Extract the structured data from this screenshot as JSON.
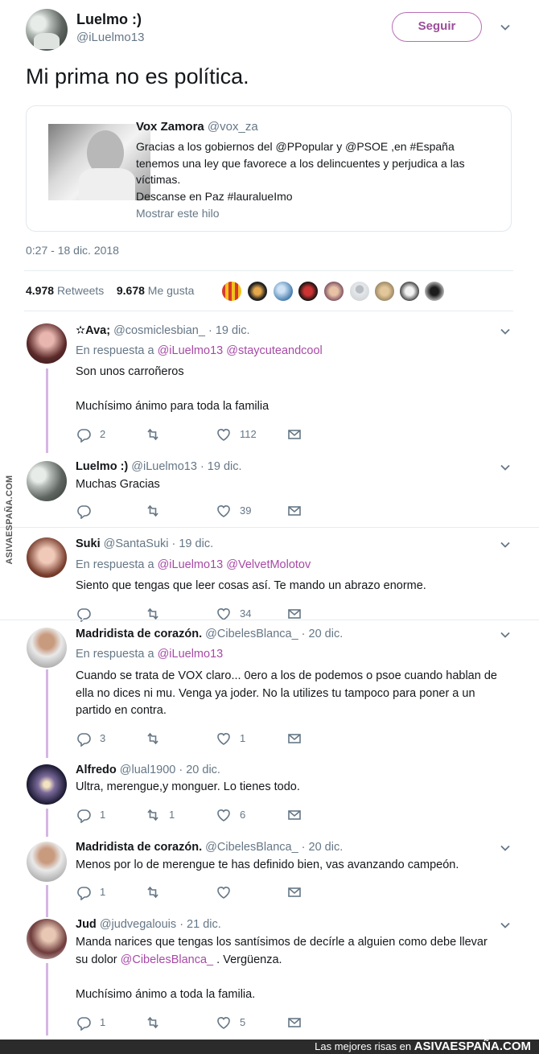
{
  "author": {
    "name": "Luelmo :)",
    "handle": "@iLuelmo13",
    "follow_label": "Seguir"
  },
  "tweet": {
    "text": "Mi prima no es política."
  },
  "quoted": {
    "name": "Vox Zamora",
    "handle": "@vox_za",
    "lines": [
      "Gracias a los gobiernos del @PPopular y @PSOE  ,en #España",
      "tenemos una ley que favorece a los delincuentes y perjudica a las",
      "víctimas.",
      "Descanse en Paz #lauralueImo"
    ],
    "show_thread": "Mostrar este hilo"
  },
  "timestamp": "0:27 - 18 dic. 2018",
  "stats": {
    "retweets": "4.978",
    "retweets_label": "Retweets",
    "likes": "9.678",
    "likes_label": "Me gusta"
  },
  "replies": [
    {
      "name": "✫Ava;",
      "handle": "@cosmiclesbian_",
      "date": "· 19 dic.",
      "respond_prefix": "En respuesta a",
      "mentions": [
        "@iLuelmo13",
        "@staycuteandcool"
      ],
      "lines": [
        "Son unos carroñeros",
        "",
        "Muchísimo ánimo para toda la familia"
      ],
      "replies": "2",
      "retweets": "",
      "likes": "112"
    },
    {
      "name": "Luelmo :)",
      "handle": "@iLuelmo13",
      "date": "· 19 dic.",
      "lines": [
        "Muchas Gracias"
      ],
      "replies": "",
      "retweets": "",
      "likes": "39"
    },
    {
      "name": "Suki",
      "handle": "@SantaSuki",
      "date": "· 19 dic.",
      "respond_prefix": "En respuesta a",
      "mentions": [
        "@iLuelmo13",
        "@VelvetMolotov"
      ],
      "lines": [
        "Siento que tengas que leer cosas así. Te mando un abrazo enorme."
      ],
      "replies": "",
      "retweets": "",
      "likes": "34"
    },
    {
      "name": "Madridista de corazón.",
      "handle": "@CibelesBlanca_",
      "date": "· 20 dic.",
      "respond_prefix": "En respuesta a",
      "mentions": [
        "@iLuelmo13"
      ],
      "lines": [
        "Cuando se trata de VOX claro... 0ero a los de podemos o psoe cuando hablan de",
        "ella no dices ni mu. Venga ya joder. No la utilizes tu tampoco para poner a un",
        "partido en contra."
      ],
      "replies": "3",
      "retweets": "",
      "likes": "1"
    },
    {
      "name": "Alfredo",
      "handle": "@lual1900",
      "date": "· 20 dic.",
      "lines": [
        "Ultra, merengue,y monguer. Lo tienes todo."
      ],
      "replies": "1",
      "retweets": "1",
      "likes": "6"
    },
    {
      "name": "Madridista de corazón.",
      "handle": "@CibelesBlanca_",
      "date": "· 20 dic.",
      "lines": [
        "Menos por lo de merengue te has definido bien, vas avanzando campeón."
      ],
      "replies": "1",
      "retweets": "",
      "likes": ""
    },
    {
      "name": "Jud",
      "handle": "@judvegalouis",
      "date": "· 21 dic.",
      "line1": "Manda narices que tengas los santísimos de decírle a alguien como debe llevar",
      "line2_prefix": "su dolor ",
      "line2_mention": "@CibelesBlanca_",
      "line2_suffix": " . Vergüenza.",
      "line3": "Muchísimo ánimo a toda la familia.",
      "replies": "1",
      "retweets": "",
      "likes": "5"
    }
  ],
  "footer": {
    "prefix": "Las mejores risas en",
    "brand": "ASIVAESPAÑA.COM"
  },
  "watermark": "ASIVAESPAÑA.COM",
  "colors": {
    "accent": "#a74aa6",
    "thread": "#d6b6e4",
    "muted": "#657786"
  },
  "icons": [
    "chevron-down-icon",
    "reply-icon",
    "retweet-icon",
    "like-icon",
    "message-icon"
  ]
}
